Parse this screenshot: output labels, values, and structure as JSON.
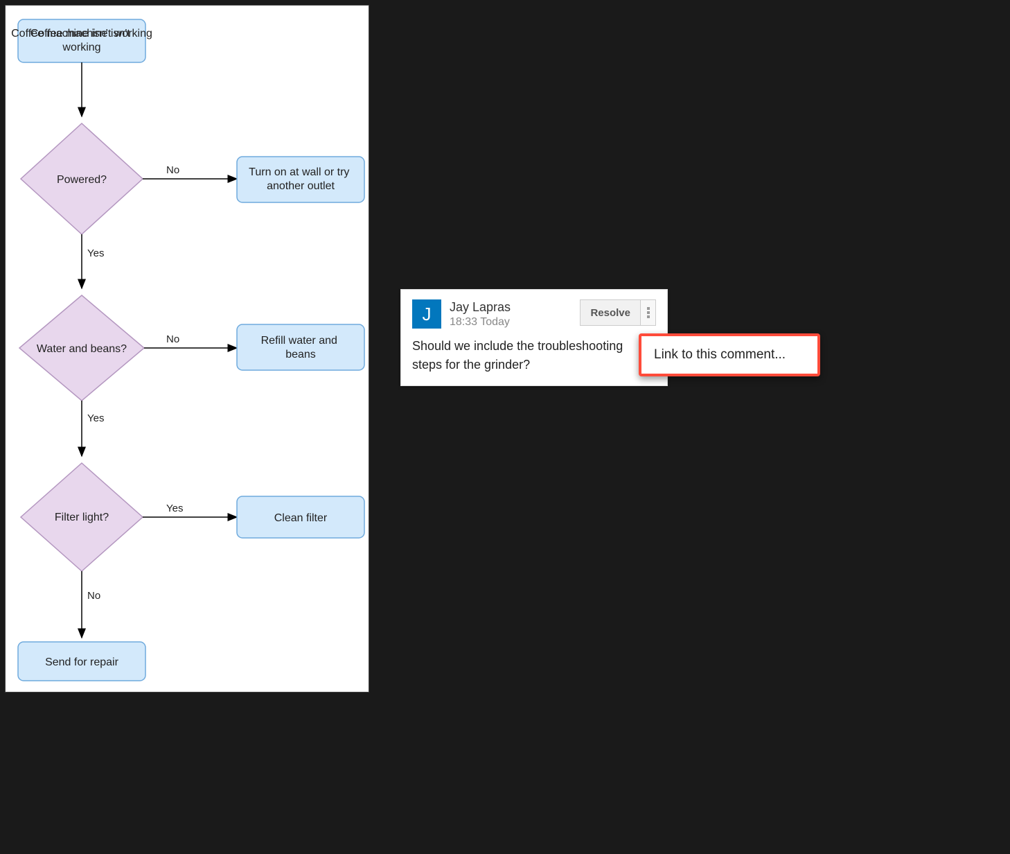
{
  "diagram": {
    "start": "Coffee machine isn't working",
    "decisions": {
      "powered": {
        "label": "Powered?",
        "no_label": "No",
        "yes_label": "Yes"
      },
      "water_beans": {
        "label": "Water and beans?",
        "no_label": "No",
        "yes_label": "Yes"
      },
      "filter_light": {
        "label": "Filter light?",
        "yes_label": "Yes",
        "no_label": "No"
      }
    },
    "actions": {
      "turn_on": "Turn on at wall or try another outlet",
      "refill": "Refill water and beans",
      "clean": "Clean filter",
      "repair": "Send for repair"
    }
  },
  "comment": {
    "avatar_initial": "J",
    "author": "Jay Lapras",
    "time": "18:33 Today",
    "resolve_label": "Resolve",
    "body": "Should we include the troubleshooting steps for the grinder?"
  },
  "popup": {
    "link_label": "Link to this comment..."
  },
  "colors": {
    "process_fill": "#d3e9fb",
    "process_stroke": "#6faadd",
    "decision_fill": "#e8d7ed",
    "decision_stroke": "#b497c0",
    "avatar_bg": "#0277BD",
    "highlight": "#ff4b3a"
  }
}
